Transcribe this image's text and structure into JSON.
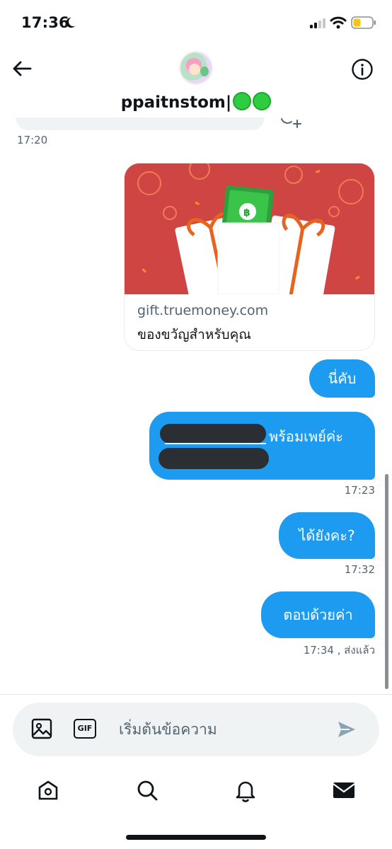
{
  "status_bar": {
    "time": "17:36",
    "battery_color": "#f5c518"
  },
  "header": {
    "display_name": "ppaitnstom|",
    "accent": "#2ecc40"
  },
  "conversation": {
    "earlier_timestamp": "17:20",
    "link_card": {
      "domain": "gift.truemoney.com",
      "title": "ของขวัญสำหรับคุณ",
      "image_color": "#cf4543"
    },
    "messages": [
      {
        "text": "นี่คับ"
      },
      {
        "text": "พร้อมเพย์ค่ะ",
        "timestamp": "17:23"
      },
      {
        "text": "ได้ยังคะ?",
        "timestamp": "17:32"
      },
      {
        "text": "ตอบด้วยค่า",
        "timestamp": "17:34 , ส่งแล้ว"
      }
    ],
    "bubble_color": "#1d9bf0"
  },
  "composer": {
    "gif_label": "GIF",
    "placeholder": "เริ่มต้นข้อความ"
  },
  "tabbar": {
    "items": [
      "home-icon",
      "search-icon",
      "notifications-icon",
      "messages-icon"
    ]
  }
}
